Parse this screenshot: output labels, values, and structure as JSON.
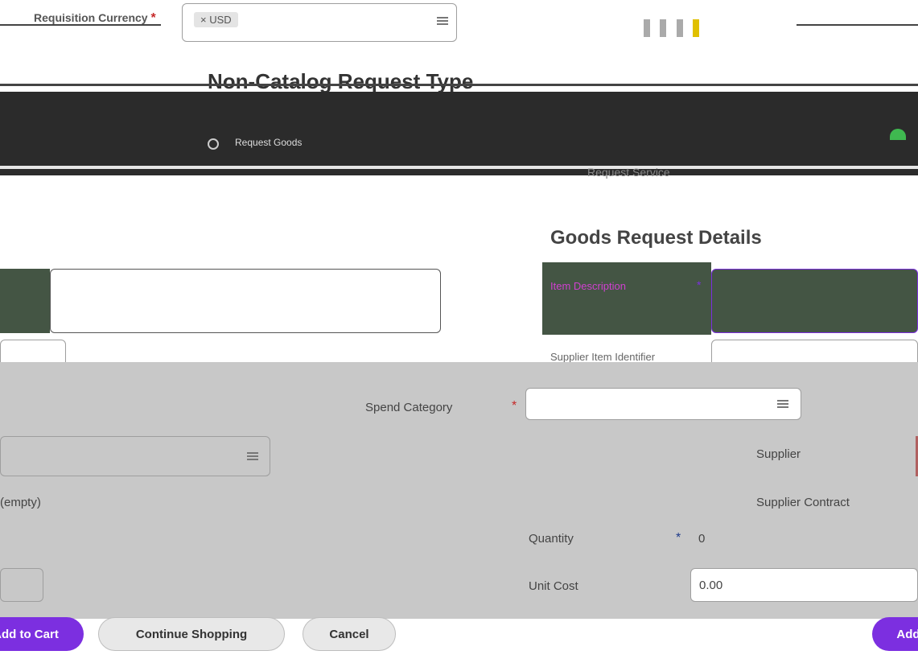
{
  "header": {
    "currency_label": "Requisition Currency",
    "currency_value": "USD",
    "page_title": "Non-Catalog Request Type"
  },
  "types": {
    "request_goods": "Request Goods",
    "request_service": "Request Service"
  },
  "goods": {
    "section_title": "Goods Request Details",
    "item_description_label": "Item Description",
    "supplier_item_identifier_label": "Supplier Item Identifier",
    "spend_category_label": "Spend Category",
    "supplier_label": "Supplier",
    "supplier_contract_label": "Supplier Contract",
    "supplier_contract_value": "(empty)",
    "quantity_label": "Quantity",
    "quantity_value": "0",
    "unit_cost_label": "Unit Cost",
    "unit_cost_value": "0.00"
  },
  "buttons": {
    "add_to_cart": "Add to Cart",
    "continue_shopping": "Continue Shopping",
    "cancel": "Cancel",
    "add": "Add"
  },
  "colors": {
    "accent": "#7c2fe0",
    "dark_band": "#2b2b2b",
    "gray_band": "#c8c8c8",
    "required": "#c62828",
    "green_block": "#445544"
  }
}
